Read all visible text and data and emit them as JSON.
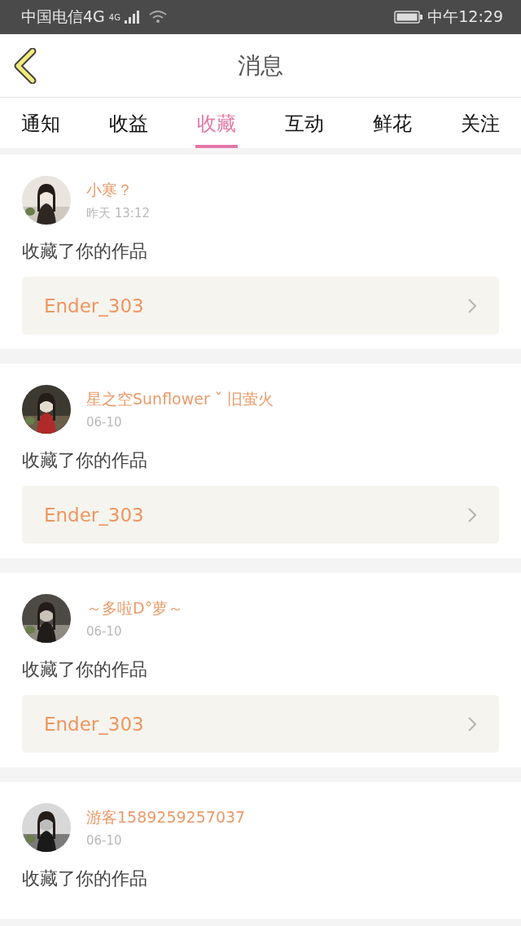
{
  "status_bar": {
    "carrier": "中国电信4G",
    "network_badge": "4G",
    "time": "中午12:29"
  },
  "header": {
    "title": "消息"
  },
  "tabs": [
    {
      "label": "通知",
      "selected": false
    },
    {
      "label": "收益",
      "selected": false
    },
    {
      "label": "收藏",
      "selected": true
    },
    {
      "label": "互动",
      "selected": false
    },
    {
      "label": "鲜花",
      "selected": false
    },
    {
      "label": "关注",
      "selected": false
    }
  ],
  "messages": [
    {
      "name": "小寒？",
      "time": "昨天 13:12",
      "text": "收藏了你的作品",
      "work": "Ender_303"
    },
    {
      "name": "星之空Sunflower ˇ 旧萤火",
      "time": "06-10",
      "text": "收藏了你的作品",
      "work": "Ender_303"
    },
    {
      "name": "～多啦D°萝～",
      "time": "06-10",
      "text": "收藏了你的作品",
      "work": "Ender_303"
    },
    {
      "name": "游客1589259257037",
      "time": "06-10",
      "text": "收藏了你的作品"
    }
  ]
}
